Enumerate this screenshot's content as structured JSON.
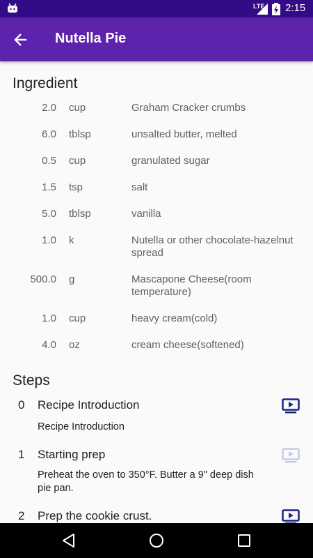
{
  "status_bar": {
    "network": "LTE",
    "time": "2:15"
  },
  "app_bar": {
    "title": "Nutella Pie"
  },
  "ingredients_heading": "Ingredient",
  "ingredients": [
    {
      "qty": "2.0",
      "unit": "cup",
      "name": "Graham Cracker crumbs"
    },
    {
      "qty": "6.0",
      "unit": "tblsp",
      "name": "unsalted butter, melted"
    },
    {
      "qty": "0.5",
      "unit": "cup",
      "name": "granulated sugar"
    },
    {
      "qty": "1.5",
      "unit": "tsp",
      "name": "salt"
    },
    {
      "qty": "5.0",
      "unit": "tblsp",
      "name": "vanilla"
    },
    {
      "qty": "1.0",
      "unit": "k",
      "name": "Nutella or other chocolate-hazelnut spread"
    },
    {
      "qty": "500.0",
      "unit": "g",
      "name": "Mascapone Cheese(room temperature)"
    },
    {
      "qty": "1.0",
      "unit": "cup",
      "name": "heavy cream(cold)"
    },
    {
      "qty": "4.0",
      "unit": "oz",
      "name": "cream cheese(softened)"
    }
  ],
  "steps_heading": "Steps",
  "steps": [
    {
      "num": "0",
      "short": "Recipe Introduction",
      "desc": "Recipe Introduction",
      "has_video": true
    },
    {
      "num": "1",
      "short": "Starting prep",
      "desc": "Preheat the oven to 350°F. Butter a 9\" deep dish pie pan.",
      "has_video": false
    },
    {
      "num": "2",
      "short": "Prep the cookie crust.",
      "desc": "",
      "has_video": true
    }
  ],
  "colors": {
    "status_bar": "#320b86",
    "app_bar": "#5e23ac",
    "video_active": "#1a237e",
    "video_disabled": "#c5cae9"
  },
  "icons": {
    "back": "arrow-back-icon",
    "video": "ondemand-video-icon",
    "nav_back": "triangle-back-icon",
    "nav_home": "circle-home-icon",
    "nav_recents": "square-recents-icon"
  }
}
